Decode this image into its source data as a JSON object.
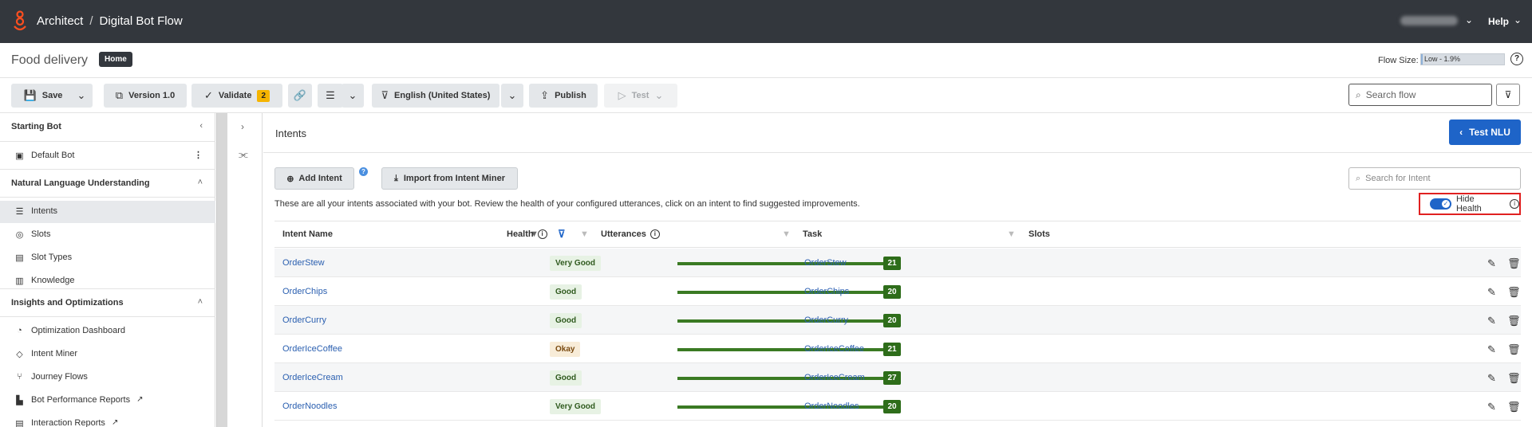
{
  "topbar": {
    "app": "Architect",
    "separator": "/",
    "flow_type": "Digital Bot Flow",
    "help": "Help",
    "logo_icon": "genesys-logo-icon"
  },
  "title_row": {
    "flow_name": "Food delivery",
    "home_badge": "Home",
    "flow_size_label": "Flow Size:",
    "flow_size_value": "Low - 1.9%",
    "flow_size_percent": 1.9
  },
  "toolbar": {
    "save": "Save",
    "version": "Version 1.0",
    "validate": "Validate",
    "validate_count": "2",
    "language": "English (United States)",
    "publish": "Publish",
    "test": "Test",
    "search_placeholder": "Search flow"
  },
  "sidebar": {
    "starting_bot_header": "Starting Bot",
    "default_bot": "Default Bot",
    "nlu_header": "Natural Language Understanding",
    "nlu_items": [
      "Intents",
      "Slots",
      "Slot Types",
      "Knowledge"
    ],
    "insights_header": "Insights and Optimizations",
    "insights_items": [
      "Optimization Dashboard",
      "Intent Miner",
      "Journey Flows",
      "Bot Performance Reports",
      "Interaction Reports"
    ]
  },
  "main": {
    "title": "Intents",
    "test_nlu": "Test NLU",
    "add_intent": "Add Intent",
    "import": "Import from Intent Miner",
    "search_placeholder": "Search for Intent",
    "description": "These are all your intents associated with your bot. Review the health of your configured utterances, click on an intent to find suggested improvements.",
    "hide_health": "Hide Health",
    "hide_health_on": true
  },
  "table": {
    "columns": [
      "Intent Name",
      "Health",
      "Utterances",
      "Task",
      "Slots"
    ],
    "rows": [
      {
        "name": "OrderStew",
        "health": "Very Good",
        "utterances": "21",
        "task": "OrderStew"
      },
      {
        "name": "OrderChips",
        "health": "Good",
        "utterances": "20",
        "task": "OrderChips"
      },
      {
        "name": "OrderCurry",
        "health": "Good",
        "utterances": "20",
        "task": "OrderCurry"
      },
      {
        "name": "OrderIceCoffee",
        "health": "Okay",
        "utterances": "21",
        "task": "OrderIceCoffee"
      },
      {
        "name": "OrderIceCream",
        "health": "Good",
        "utterances": "27",
        "task": "OrderIceCream"
      },
      {
        "name": "OrderNoodles",
        "health": "Very Good",
        "utterances": "20",
        "task": "OrderNoodles"
      }
    ]
  },
  "colors": {
    "topbar": "#33373d",
    "primary": "#1e64c8",
    "utterance_bar": "#3a7a23",
    "highlight_box": "#e02020"
  }
}
